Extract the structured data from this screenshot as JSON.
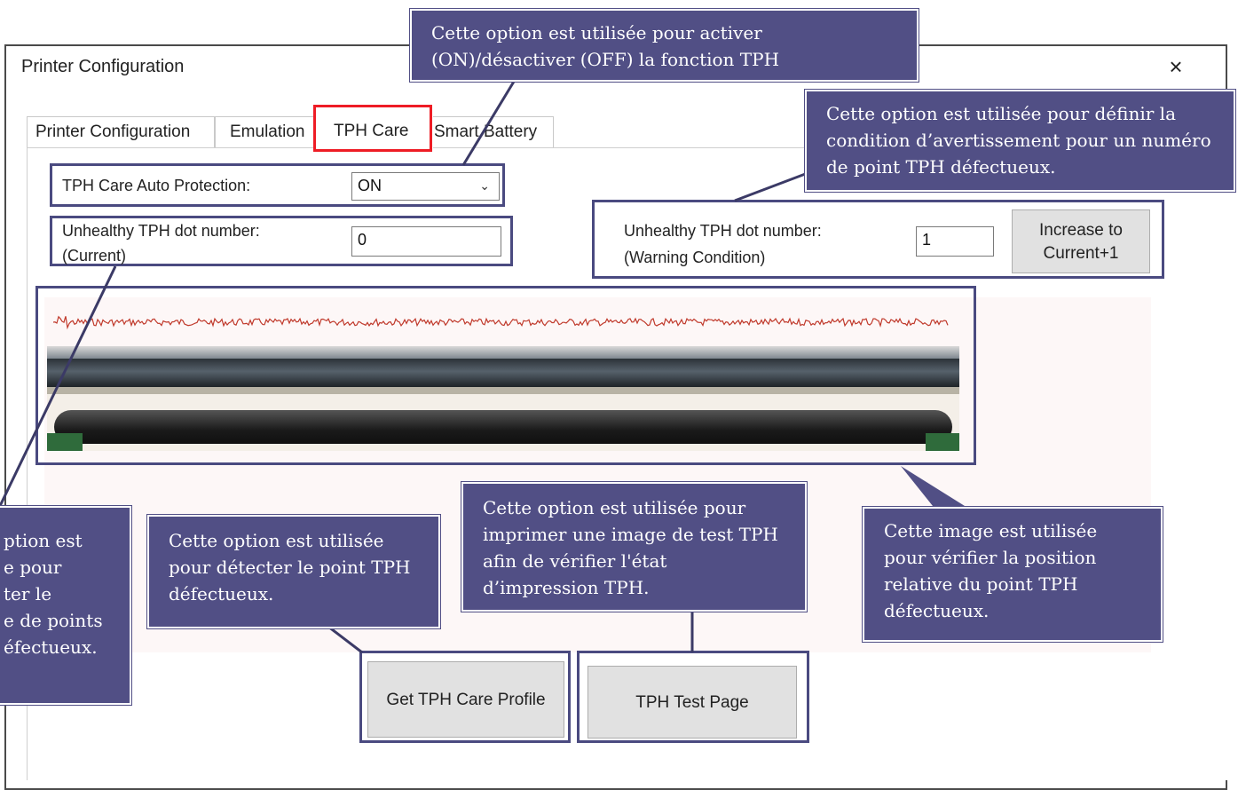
{
  "window": {
    "title": "Printer Configuration",
    "close_glyph": "×"
  },
  "tabs": [
    {
      "label": "Printer Configuration"
    },
    {
      "label": "Emulation"
    },
    {
      "label": "TPH Care"
    },
    {
      "label": "Smart Battery"
    }
  ],
  "auto_protection": {
    "label": "TPH Care Auto Protection:",
    "value": "ON"
  },
  "current_dots": {
    "label_line1": "Unhealthy TPH dot number:",
    "label_line2": "(Current)",
    "value": "0"
  },
  "warning_dots": {
    "label_line1": "Unhealthy TPH dot number:",
    "label_line2": "(Warning Condition)",
    "value": "1",
    "button_line1": "Increase to",
    "button_line2": "Current+1"
  },
  "buttons": {
    "get_profile": "Get TPH Care Profile",
    "test_page": "TPH Test Page"
  },
  "callouts": {
    "auto_protection": "Cette option est utilisée pour activer (ON)/désactiver (OFF) la fonction TPH",
    "warning_condition": "Cette option est utilisée pour définir la condition d’avertissement pour un numéro de point TPH défectueux.",
    "current_count": "ption est\ne pour\nter le\ne de points\néfectueux.",
    "detect_dot": "Cette option est utilisée pour détecter le point TPH défectueux.",
    "test_image": "Cette option est utilisée pour imprimer une image de test TPH afin de vérifier l'état d’impression TPH.",
    "position_image": "Cette image est utilisée pour vérifier la position relative du point TPH défectueux."
  },
  "colors": {
    "callout_bg": "#514f85",
    "frame": "#4a4a80",
    "active_tab_highlight": "#ee1c25"
  }
}
